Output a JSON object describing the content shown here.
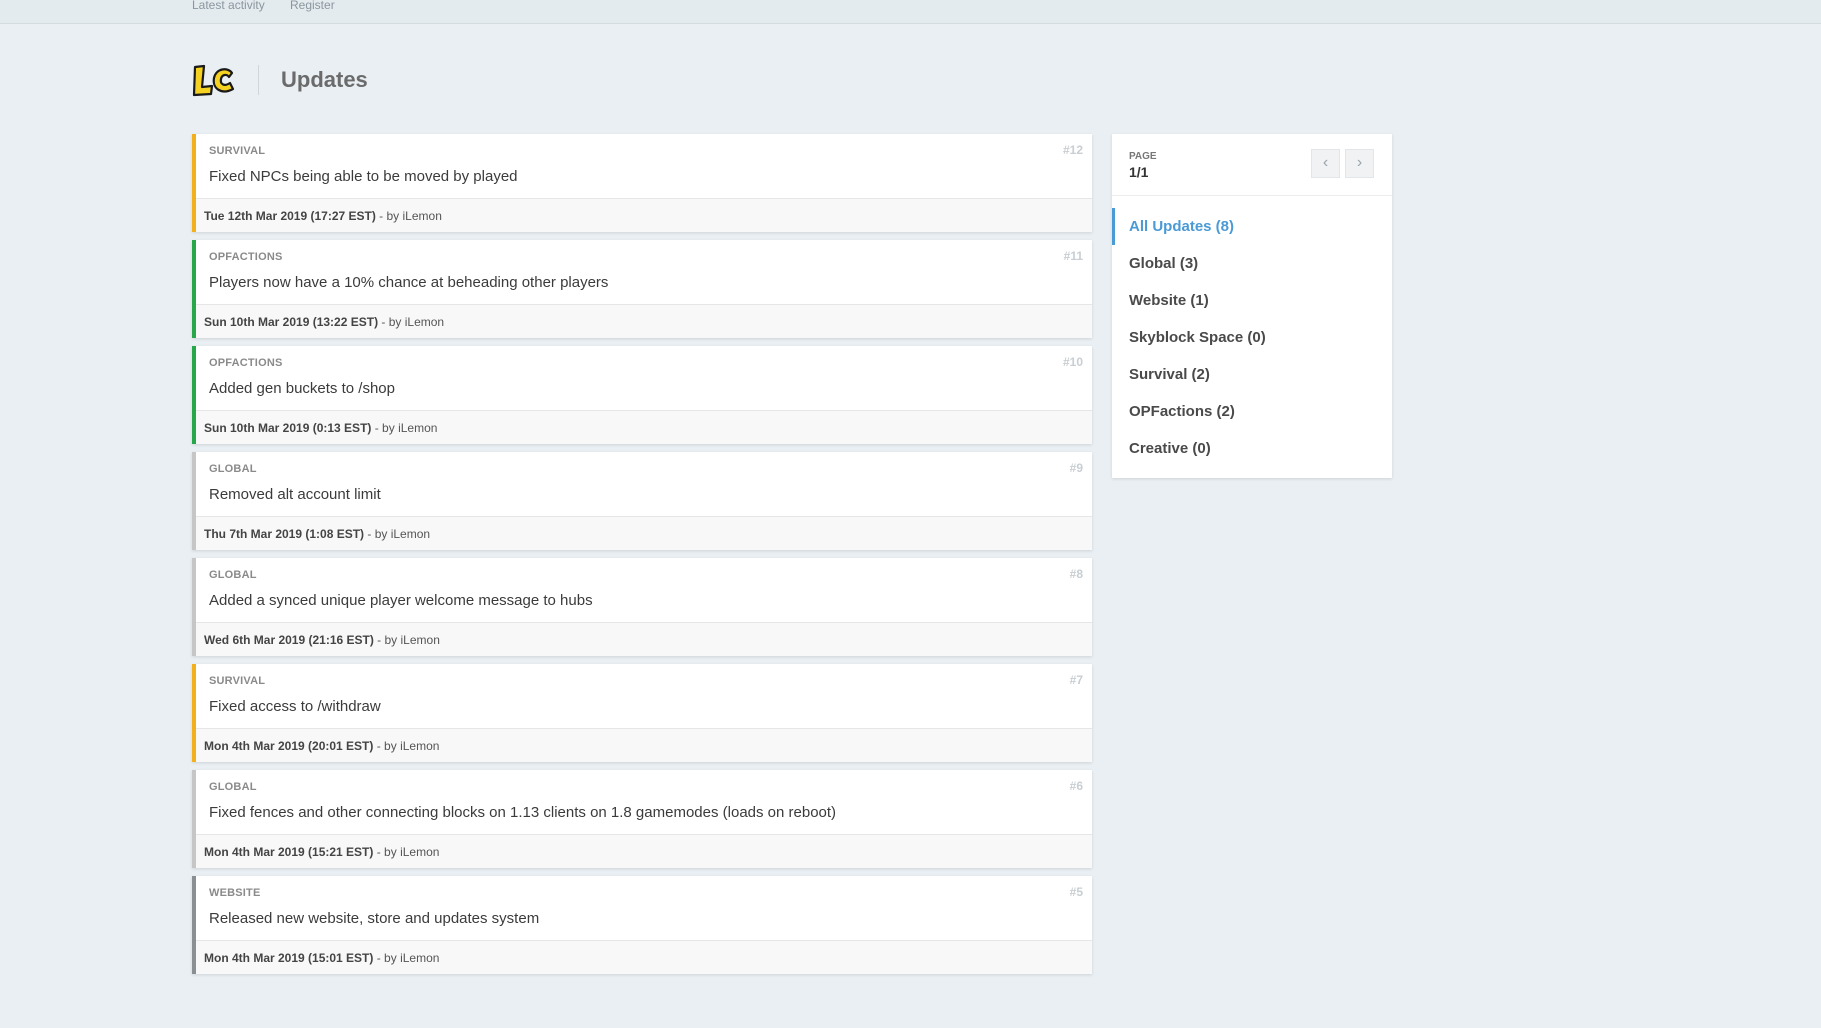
{
  "topnav": {
    "links": [
      "Latest activity",
      "Register"
    ]
  },
  "header": {
    "logo_text": "LC",
    "title": "Updates"
  },
  "colors": {
    "survival": "#f2b01e",
    "opfactions": "#27a74a",
    "global": "#c6c6c6",
    "website": "#8a8f94",
    "accent": "#4a9ad6"
  },
  "updates": [
    {
      "category": "SURVIVAL",
      "number": "#12",
      "message": "Fixed NPCs being able to be moved by played",
      "date": "Tue 12th Mar 2019 (17:27 EST)",
      "by": " - by iLemon",
      "color": "#f2b01e"
    },
    {
      "category": "OPFACTIONS",
      "number": "#11",
      "message": "Players now have a 10% chance at beheading other players",
      "date": "Sun 10th Mar 2019 (13:22 EST)",
      "by": " - by iLemon",
      "color": "#27a74a"
    },
    {
      "category": "OPFACTIONS",
      "number": "#10",
      "message": "Added gen buckets to /shop",
      "date": "Sun 10th Mar 2019 (0:13 EST)",
      "by": " - by iLemon",
      "color": "#27a74a"
    },
    {
      "category": "GLOBAL",
      "number": "#9",
      "message": "Removed alt account limit",
      "date": "Thu 7th Mar 2019 (1:08 EST)",
      "by": " - by iLemon",
      "color": "#c6c6c6"
    },
    {
      "category": "GLOBAL",
      "number": "#8",
      "message": "Added a synced unique player welcome message to hubs",
      "date": "Wed 6th Mar 2019 (21:16 EST)",
      "by": " - by iLemon",
      "color": "#c6c6c6"
    },
    {
      "category": "SURVIVAL",
      "number": "#7",
      "message": "Fixed access to /withdraw",
      "date": "Mon 4th Mar 2019 (20:01 EST)",
      "by": " - by iLemon",
      "color": "#f2b01e"
    },
    {
      "category": "GLOBAL",
      "number": "#6",
      "message": "Fixed fences and other connecting blocks on 1.13 clients on 1.8 gamemodes (loads on reboot)",
      "date": "Mon 4th Mar 2019 (15:21 EST)",
      "by": " - by iLemon",
      "color": "#c6c6c6"
    },
    {
      "category": "WEBSITE",
      "number": "#5",
      "message": "Released new website, store and updates system",
      "date": "Mon 4th Mar 2019 (15:01 EST)",
      "by": " - by iLemon",
      "color": "#8a8f94"
    }
  ],
  "sidebar": {
    "page_label": "PAGE",
    "page_value": "1/1",
    "prev_icon": "chevron-left-icon",
    "next_icon": "chevron-right-icon",
    "categories": [
      {
        "label": "All Updates (8)",
        "active": true
      },
      {
        "label": "Global (3)",
        "active": false
      },
      {
        "label": "Website (1)",
        "active": false
      },
      {
        "label": "Skyblock Space (0)",
        "active": false
      },
      {
        "label": "Survival (2)",
        "active": false
      },
      {
        "label": "OPFactions (2)",
        "active": false
      },
      {
        "label": "Creative (0)",
        "active": false
      }
    ]
  }
}
